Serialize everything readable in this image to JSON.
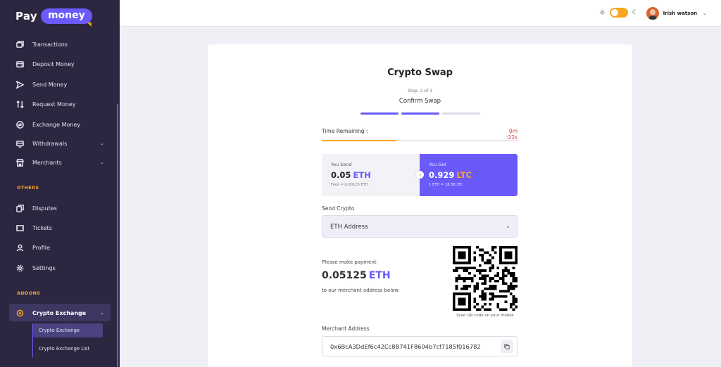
{
  "brand": {
    "part1": "Pay",
    "part2": "money"
  },
  "colors": {
    "accent": "#6a5af9",
    "orange": "#f5a623",
    "sidebar_bg": "#2c2640",
    "danger": "#e03131"
  },
  "sidebar": {
    "main_items": [
      {
        "label": "Transactions",
        "icon": "transactions-icon"
      },
      {
        "label": "Deposit Money",
        "icon": "deposit-icon"
      },
      {
        "label": "Send Money",
        "icon": "send-icon"
      },
      {
        "label": "Request Money",
        "icon": "request-icon"
      },
      {
        "label": "Exchange Money",
        "icon": "exchange-icon"
      },
      {
        "label": "Withdrawals",
        "icon": "withdrawal-icon"
      },
      {
        "label": "Merchants",
        "icon": "merchant-icon"
      }
    ],
    "others_label": "OTHERS",
    "others_items": [
      {
        "label": "Disputes",
        "icon": "disputes-icon"
      },
      {
        "label": "Tickets",
        "icon": "ticket-icon"
      },
      {
        "label": "Profile",
        "icon": "profile-icon"
      },
      {
        "label": "Settings",
        "icon": "settings-icon"
      }
    ],
    "addons_label": "ADDONS",
    "addon_item": {
      "label": "Crypto Exchange",
      "icon": "crypto-exchange-icon"
    },
    "sub_items": [
      {
        "label": "Crypto Exchange"
      },
      {
        "label": "Crypto Exchange List"
      }
    ]
  },
  "header": {
    "user_name": "Irish watson"
  },
  "swap": {
    "title": "Crypto Swap",
    "step_count": "Step: 2 of 3",
    "step_name": "Confirm Swap",
    "steps_completed": 2,
    "steps_total": 3,
    "time_label": "Time Remaining :",
    "time_value": "0m :22s",
    "time_progress": 0.38,
    "send": {
      "label": "You Send",
      "amount": "0.05",
      "currency": "ETH",
      "note": "Fees = 0.00125 ETH"
    },
    "get": {
      "label": "You Get",
      "amount": "0.929",
      "currency": "LTC",
      "note": "1 ETH = 18.58 LTC"
    },
    "send_crypto_label": "Send Crypto",
    "send_crypto_value": "ETH Address",
    "payment_prompt": "Please make payment",
    "payment_amount": "0.05125",
    "payment_currency": "ETH",
    "payment_sub": "to our merchant address below",
    "qr_caption": "Scan QR code on your mobile",
    "merchant_label": "Merchant Address",
    "merchant_address": "0x6BcA3DdEf6c42Cc8B741F8604b7cf7185f016782"
  }
}
